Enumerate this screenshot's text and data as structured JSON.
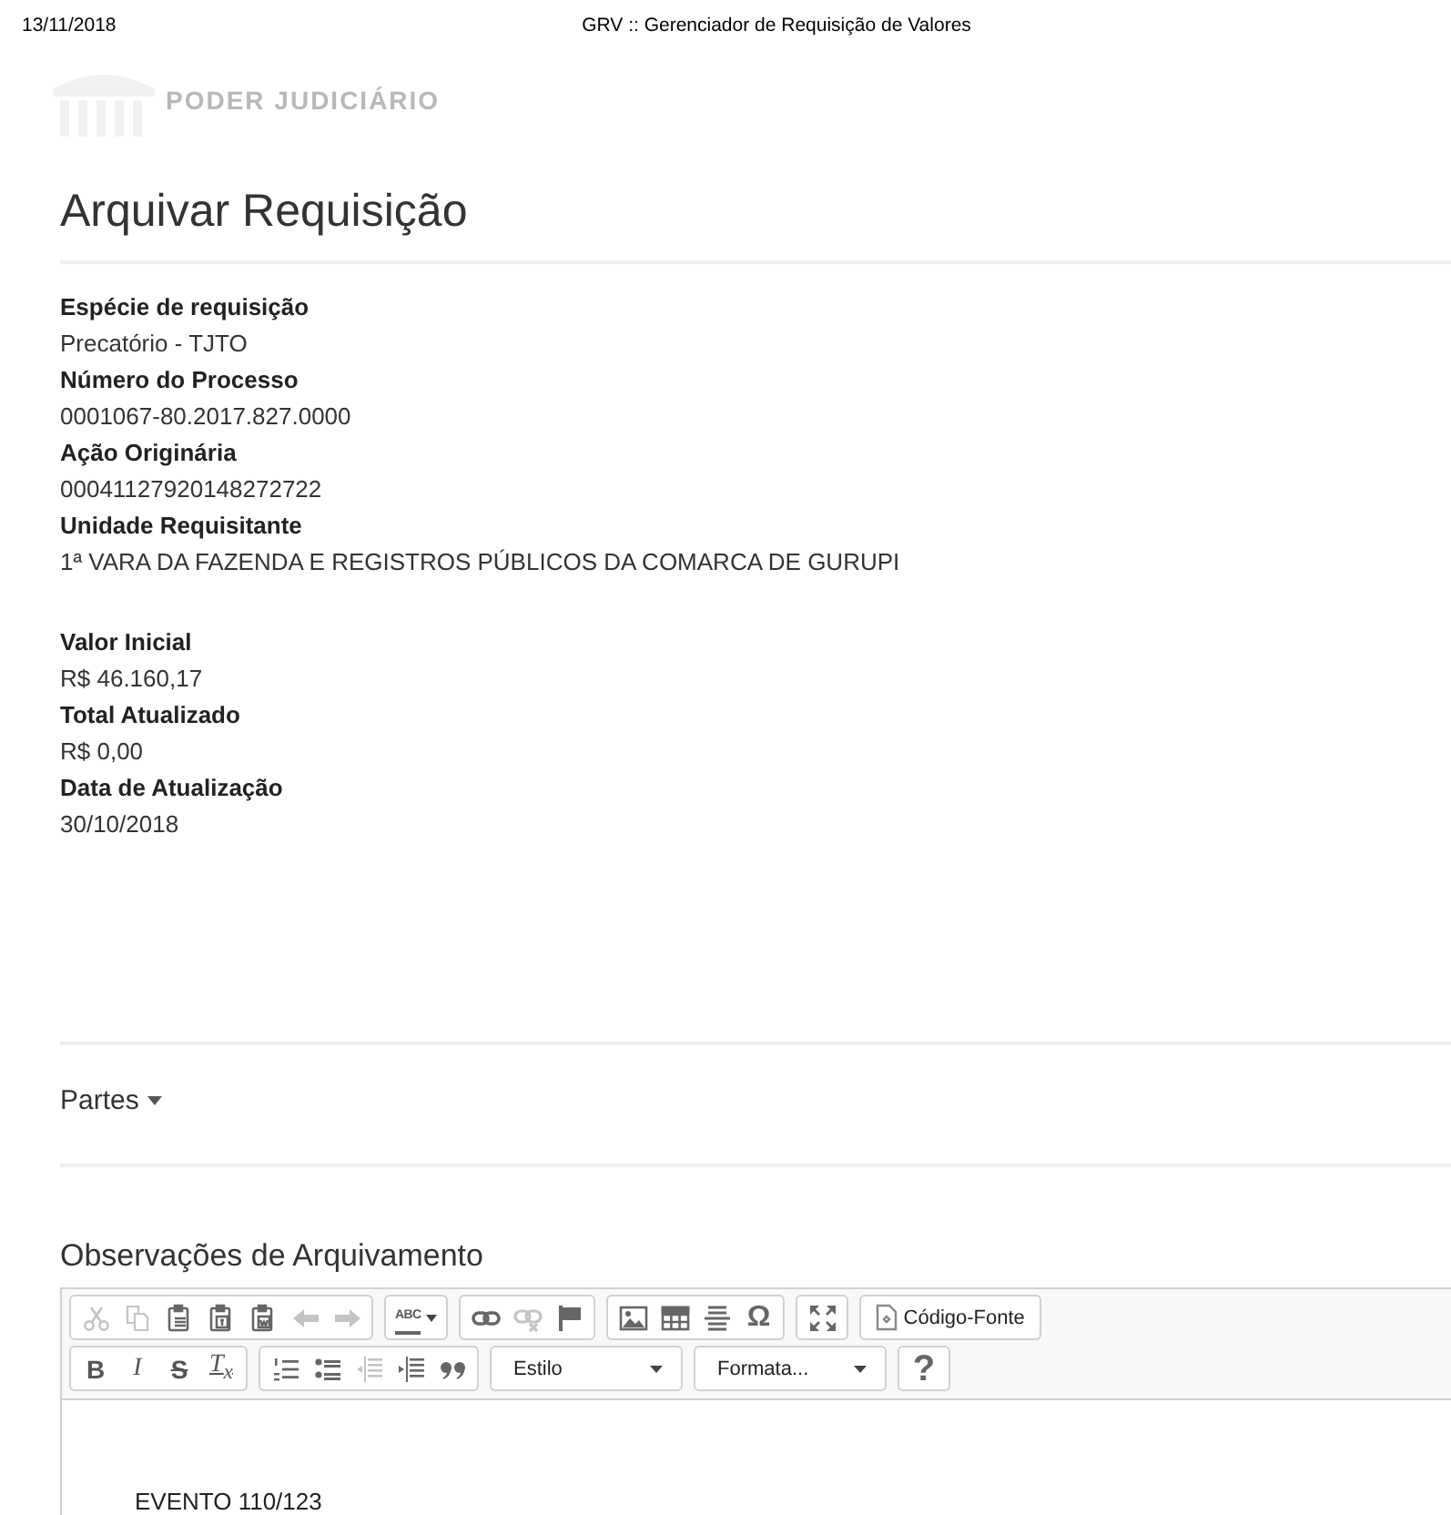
{
  "print_header": {
    "date": "13/11/2018",
    "title": "GRV :: Gerenciador de Requisição de Valores"
  },
  "logo": {
    "title": "PODER JUDICIÁRIO"
  },
  "page_title": "Arquivar Requisição",
  "field_groups": [
    {
      "fields": [
        {
          "label": "Espécie de requisição",
          "value": "Precatório - TJTO"
        },
        {
          "label": "Número do Processo",
          "value": "0001067-80.2017.827.0000"
        },
        {
          "label": "Ação Originária",
          "value": "00041127920148272722"
        },
        {
          "label": "Unidade Requisitante",
          "value": "1ª VARA DA FAZENDA E REGISTROS PÚBLICOS DA COMARCA DE GURUPI"
        }
      ]
    },
    {
      "fields": [
        {
          "label": "Valor Inicial",
          "value": "R$ 46.160,17"
        },
        {
          "label": "Total Atualizado",
          "value": "R$ 0,00"
        },
        {
          "label": "Data de Atualização",
          "value": "30/10/2018"
        }
      ]
    }
  ],
  "parties_toggle": {
    "label": "Partes"
  },
  "editor": {
    "heading": "Observações de Arquivamento",
    "toolbar_rows": [
      {
        "groups": [
          {
            "buttons": [
              {
                "kind": "icon",
                "disabled": true
              },
              {
                "kind": "icon",
                "disabled": true
              },
              {
                "kind": "icon",
                "disabled": false
              },
              {
                "kind": "icon",
                "disabled": false
              },
              {
                "kind": "icon",
                "disabled": false
              },
              {
                "kind": "icon",
                "disabled": true
              },
              {
                "kind": "icon",
                "disabled": true
              }
            ]
          },
          {
            "buttons": [
              {
                "kind": "glyph",
                "label": "ABC",
                "disabled": false
              }
            ]
          },
          {
            "buttons": [
              {
                "kind": "icon",
                "disabled": false
              },
              {
                "kind": "icon",
                "disabled": true
              },
              {
                "kind": "icon",
                "disabled": false
              }
            ]
          },
          {
            "buttons": [
              {
                "kind": "icon",
                "disabled": false
              },
              {
                "kind": "icon",
                "disabled": false
              },
              {
                "kind": "icon",
                "disabled": false
              },
              {
                "kind": "glyph",
                "label": "Ω",
                "disabled": false
              }
            ]
          },
          {
            "buttons": [
              {
                "kind": "icon",
                "disabled": false
              }
            ]
          },
          {
            "buttons": [
              {
                "kind": "text",
                "label": "Código-Fonte"
              }
            ]
          }
        ]
      },
      {
        "groups": [
          {
            "buttons": [
              {
                "kind": "glyph",
                "label": "B",
                "disabled": false
              },
              {
                "kind": "glyph",
                "label": "I",
                "disabled": false
              },
              {
                "kind": "glyph",
                "label": "S",
                "disabled": false
              },
              {
                "kind": "glyph",
                "label": "T$_{x}$",
                "disabled": false
              }
            ]
          },
          {
            "buttons": [
              {
                "kind": "icon",
                "disabled": false
              },
              {
                "kind": "icon",
                "disabled": false
              },
              {
                "kind": "icon",
                "disabled": true
              },
              {
                "kind": "icon",
                "disabled": false
              },
              {
                "kind": "icon",
                "disabled": false
              }
            ]
          },
          {
            "buttons": [
              {
                "kind": "dropdown",
                "label": "Estilo"
              }
            ]
          },
          {
            "buttons": [
              {
                "kind": "dropdown",
                "label": "Formata..."
              }
            ]
          },
          {
            "buttons": [
              {
                "kind": "glyph",
                "label": "?",
                "disabled": false
              }
            ]
          }
        ]
      }
    ],
    "content": "EVENTO 110/123"
  }
}
